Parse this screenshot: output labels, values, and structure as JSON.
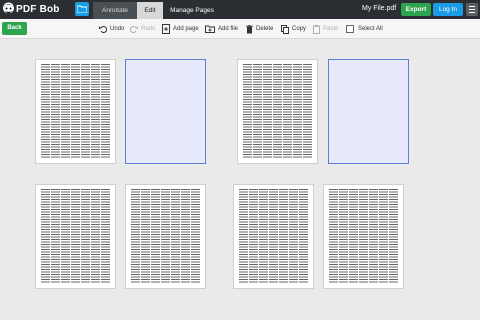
{
  "app": {
    "title": "PDF Bob"
  },
  "tabs": [
    {
      "label": "Annotate",
      "active": false
    },
    {
      "label": "Edit",
      "active": false
    },
    {
      "label": "Manage Pages",
      "active": true
    }
  ],
  "file": {
    "name": "My File.pdf"
  },
  "header_actions": {
    "export_label": "Export",
    "login_label": "Log In"
  },
  "toolbar": {
    "back_label": "Back",
    "undo_label": "Undo",
    "redo_label": "Redo",
    "add_page_label": "Add page",
    "add_file_label": "Add file",
    "delete_label": "Delete",
    "copy_label": "Copy",
    "paste_label": "Paste",
    "select_all_label": "Select All"
  },
  "pages": [
    {
      "type": "text"
    },
    {
      "type": "blank"
    },
    {
      "type": "text"
    },
    {
      "type": "blank"
    },
    {
      "type": "text"
    },
    {
      "type": "text"
    },
    {
      "type": "text"
    },
    {
      "type": "text"
    }
  ],
  "colors": {
    "accent_blue": "#1a9be6",
    "accent_green": "#2ea44f",
    "topbar": "#2b2f33",
    "blank_page": "#e6e8fb"
  },
  "icons": [
    "avatar-logo-icon",
    "folder-icon",
    "menu-icon",
    "undo-icon",
    "redo-icon",
    "add-page-icon",
    "add-file-icon",
    "trash-icon",
    "copy-icon",
    "paste-icon",
    "checkbox-icon"
  ]
}
